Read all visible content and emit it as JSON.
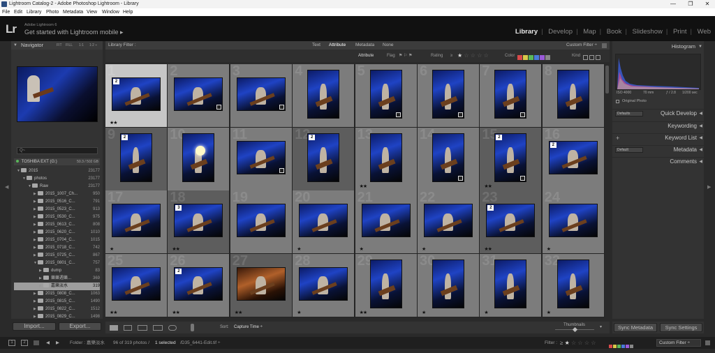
{
  "window": {
    "title": "Lightroom Catalog-2 - Adobe Photoshop Lightroom - Library",
    "minimize": "—",
    "maximize": "❐",
    "close": "✕"
  },
  "menu": [
    "File",
    "Edit",
    "Library",
    "Photo",
    "Metadata",
    "View",
    "Window",
    "Help"
  ],
  "identity": {
    "logo": "Lr",
    "sub": "Adobe Lightroom 6",
    "main": "Get started with Lightroom mobile ▸"
  },
  "modules": [
    {
      "label": "Library",
      "active": true
    },
    {
      "label": "Develop",
      "active": false
    },
    {
      "label": "Map",
      "active": false
    },
    {
      "label": "Book",
      "active": false
    },
    {
      "label": "Slideshow",
      "active": false
    },
    {
      "label": "Print",
      "active": false
    },
    {
      "label": "Web",
      "active": false
    }
  ],
  "navigator": {
    "title": "Navigator",
    "zoom_opts": [
      "FIT",
      "FILL",
      "1:1",
      "1:2 ÷"
    ]
  },
  "folders": {
    "filter_placeholder": "Q~",
    "volume": "TOSHIBA EXT (G:)",
    "volume_size": "50.3 / 502 GB",
    "rows": [
      {
        "label": "2015",
        "count": "23177",
        "indent": 0,
        "open": true
      },
      {
        "label": "photos",
        "count": "23177",
        "indent": 1,
        "open": true
      },
      {
        "label": "Raw",
        "count": "23177",
        "indent": 2,
        "open": true
      },
      {
        "label": "2015_1007_Ch...",
        "count": "950",
        "indent": 3,
        "open": false
      },
      {
        "label": "2015_0516_C...",
        "count": "791",
        "indent": 3,
        "open": false
      },
      {
        "label": "2015_0523_C...",
        "count": "913",
        "indent": 3,
        "open": false
      },
      {
        "label": "2015_0530_C...",
        "count": "975",
        "indent": 3,
        "open": false
      },
      {
        "label": "2015_0613_C...",
        "count": "808",
        "indent": 3,
        "open": false
      },
      {
        "label": "2015_0620_C...",
        "count": "1010",
        "indent": 3,
        "open": false
      },
      {
        "label": "2015_0704_C...",
        "count": "1015",
        "indent": 3,
        "open": false
      },
      {
        "label": "2015_0718_C...",
        "count": "742",
        "indent": 3,
        "open": false
      },
      {
        "label": "2015_0725_C...",
        "count": "867",
        "indent": 3,
        "open": false
      },
      {
        "label": "2015_0801_C...",
        "count": "757",
        "indent": 3,
        "open": true
      },
      {
        "label": "dump",
        "count": "83",
        "indent": 4,
        "open": false
      },
      {
        "label": "樂樂週樂...",
        "count": "369",
        "indent": 4,
        "open": false
      },
      {
        "label": "嘉樂淡水",
        "count": "319",
        "indent": 4,
        "open": false,
        "selected": true
      },
      {
        "label": "2015_0808_C...",
        "count": "1063",
        "indent": 3,
        "open": false
      },
      {
        "label": "2015_0815_C...",
        "count": "1490",
        "indent": 3,
        "open": false
      },
      {
        "label": "2015_0822_C...",
        "count": "1512",
        "indent": 3,
        "open": false
      },
      {
        "label": "2015_0829_C...",
        "count": "1498",
        "indent": 3,
        "open": false
      }
    ]
  },
  "buttons": {
    "import": "Import...",
    "export": "Export...",
    "sync_metadata": "Sync Metadata",
    "sync_settings": "Sync Settings"
  },
  "filterbar": {
    "title": "Library Filter :",
    "tabs": [
      "Text",
      "Attribute",
      "Metadata",
      "None"
    ],
    "active_tab": "Attribute",
    "preset": "Custom Filter ÷"
  },
  "attrbar": {
    "label": "Attribute",
    "flag": "Flag",
    "rating": "Rating",
    "rating_op": "≥",
    "color": "Color",
    "kind": "Kind"
  },
  "grid": {
    "cells": [
      {
        "num": "1",
        "orient": "h",
        "badge": "2",
        "stars": "★★",
        "shade": "sel"
      },
      {
        "num": "2",
        "orient": "h",
        "badge": "",
        "stars": "",
        "shade": "n",
        "flag": true
      },
      {
        "num": "3",
        "orient": "h",
        "badge": "",
        "stars": "",
        "shade": "n",
        "flag": true
      },
      {
        "num": "4",
        "orient": "v",
        "badge": "",
        "stars": "",
        "shade": "n"
      },
      {
        "num": "5",
        "orient": "v",
        "badge": "",
        "stars": "",
        "shade": "n",
        "flag": true
      },
      {
        "num": "6",
        "orient": "v",
        "badge": "",
        "stars": "",
        "shade": "n",
        "flag": true
      },
      {
        "num": "7",
        "orient": "v",
        "badge": "",
        "stars": "",
        "shade": "n",
        "flag": true
      },
      {
        "num": "8",
        "orient": "v",
        "badge": "",
        "stars": "",
        "shade": "n"
      },
      {
        "num": "9",
        "orient": "v",
        "badge": "2",
        "stars": "",
        "shade": "dk"
      },
      {
        "num": "10",
        "orient": "v",
        "badge": "",
        "stars": "",
        "shade": "n",
        "lite": true
      },
      {
        "num": "11",
        "orient": "h",
        "badge": "",
        "stars": "",
        "shade": "n",
        "flag": true
      },
      {
        "num": "12",
        "orient": "v",
        "badge": "2",
        "stars": "",
        "shade": "dk"
      },
      {
        "num": "13",
        "orient": "v",
        "badge": "",
        "stars": "★★",
        "shade": "n"
      },
      {
        "num": "14",
        "orient": "v",
        "badge": "",
        "stars": "",
        "shade": "n",
        "flag": true
      },
      {
        "num": "15",
        "orient": "v",
        "badge": "2",
        "stars": "★★",
        "shade": "dk",
        "flag": true
      },
      {
        "num": "16",
        "orient": "h",
        "badge": "2",
        "stars": "",
        "shade": "n"
      },
      {
        "num": "17",
        "orient": "h",
        "badge": "",
        "stars": "★",
        "shade": "n"
      },
      {
        "num": "18",
        "orient": "h",
        "badge": "3",
        "stars": "★★",
        "shade": "dk"
      },
      {
        "num": "19",
        "orient": "h",
        "badge": "",
        "stars": "",
        "shade": "n"
      },
      {
        "num": "20",
        "orient": "h",
        "badge": "",
        "stars": "★",
        "shade": "n"
      },
      {
        "num": "21",
        "orient": "h",
        "badge": "",
        "stars": "★",
        "shade": "n"
      },
      {
        "num": "22",
        "orient": "h",
        "badge": "",
        "stars": "★",
        "shade": "n"
      },
      {
        "num": "23",
        "orient": "h",
        "badge": "2",
        "stars": "★★",
        "shade": "dk"
      },
      {
        "num": "24",
        "orient": "h",
        "badge": "",
        "stars": "★",
        "shade": "n"
      },
      {
        "num": "25",
        "orient": "h",
        "badge": "",
        "stars": "★★",
        "shade": "n"
      },
      {
        "num": "26",
        "orient": "h",
        "badge": "2",
        "stars": "★★",
        "shade": "n"
      },
      {
        "num": "27",
        "orient": "h",
        "badge": "",
        "stars": "★★",
        "shade": "dk",
        "warm": true
      },
      {
        "num": "28",
        "orient": "h",
        "badge": "",
        "stars": "★",
        "shade": "n"
      },
      {
        "num": "29",
        "orient": "v",
        "badge": "",
        "stars": "★★",
        "shade": "n"
      },
      {
        "num": "30",
        "orient": "v",
        "badge": "",
        "stars": "★",
        "shade": "n"
      },
      {
        "num": "31",
        "orient": "v",
        "badge": "",
        "stars": "★",
        "shade": "n"
      },
      {
        "num": "32",
        "orient": "v",
        "badge": "",
        "stars": "★",
        "shade": "n"
      }
    ]
  },
  "toolbar": {
    "sort_label": "Sort:",
    "sort_value": "Capture Time ÷",
    "thumbnails": "Thumbnails"
  },
  "histogram": {
    "title": "Histogram",
    "iso": "ISO 4000",
    "focal": "70 mm",
    "aperture": "ƒ / 2.8",
    "shutter": "1/200 sec",
    "original": "Original Photo"
  },
  "right_sections": [
    {
      "label": "Quick Develop",
      "select": "Defaults"
    },
    {
      "label": "Keywording",
      "select": ""
    },
    {
      "label": "Keyword List",
      "select": "",
      "plus": "+"
    },
    {
      "label": "Metadata",
      "select": "Default"
    },
    {
      "label": "Comments",
      "select": ""
    }
  ],
  "filmstrip": {
    "pages": [
      "1",
      "2"
    ],
    "folder": "Folder : 嘉樂淡水",
    "count": "96 of 319 photos /",
    "selected": "1 selected",
    "file": "/D35_6441-Edit.tif ÷",
    "filter_label": "Filter :",
    "filter_value": "Custom Filter ÷"
  },
  "colors": {
    "accent": "#e8e8e8",
    "label_red": "#d94a4a",
    "label_yellow": "#d9c84a",
    "label_green": "#5ab85a",
    "label_blue": "#4a7ad9",
    "label_purple": "#9a5ad9"
  }
}
